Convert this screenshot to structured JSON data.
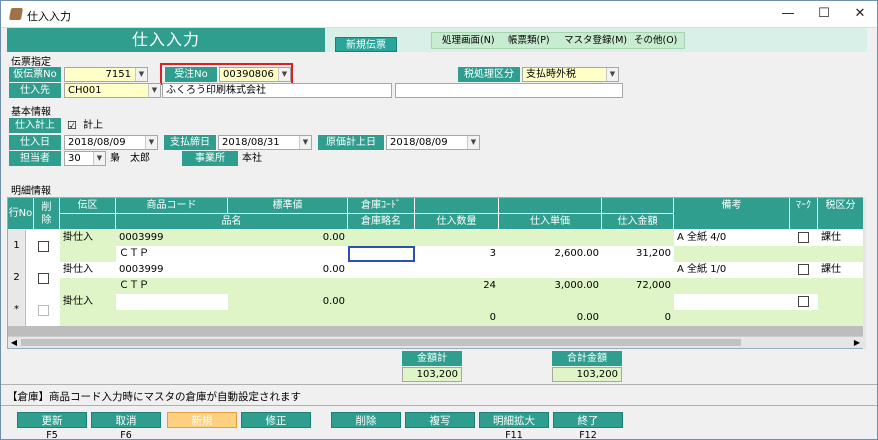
{
  "window": {
    "title": "仕入入力",
    "minimize": "—",
    "maximize": "☐",
    "close": "✕"
  },
  "header": {
    "title": "仕入入力",
    "mode_badge": "新規伝票"
  },
  "menu": [
    {
      "label": "処理画面(N)"
    },
    {
      "label": "帳票類(P)"
    },
    {
      "label": "マスタ登録(M)"
    },
    {
      "label": "その他(O)"
    }
  ],
  "denpyo": {
    "section": "伝票指定",
    "kari_label": "仮伝票No",
    "kari_value": "7151",
    "juchu_label": "受注No",
    "juchu_value": "00390806",
    "zei_label": "税処理区分",
    "zei_value": "支払時外税",
    "shiiresaki_label": "仕入先",
    "shiiresaki_code": "CH001",
    "shiiresaki_name": "ふくろう印刷株式会社"
  },
  "kihon": {
    "section": "基本情報",
    "keijo_label": "仕入計上",
    "keijo_check": "☑",
    "keijo_text": "計上",
    "shiirebi_label": "仕入日",
    "shiirebi_value": "2018/08/09",
    "shimebi_label": "支払締日",
    "shimebi_value": "2018/08/31",
    "genka_label": "原価計上日",
    "genka_value": "2018/08/09",
    "tanto_label": "担当者",
    "tanto_code": "30",
    "tanto_name": "梟　太郎",
    "jigyosho_label": "事業所",
    "jigyosho_value": "本社"
  },
  "meisai": {
    "section": "明細情報",
    "headers": {
      "gyono": "行No",
      "sakujo": "削\n除",
      "denku": "伝区",
      "shohin_code": "商品コード",
      "hyojunchi": "標準値",
      "soko_code": "倉庫ｺｰﾄﾞ",
      "hinmei": "品名",
      "soko_name": "倉庫略名",
      "suryo": "仕入数量",
      "tanka": "仕入単価",
      "kingaku": "仕入金額",
      "biko": "備考",
      "mark": "ﾏｰｸ",
      "zeiku": "税区分"
    },
    "rows": [
      {
        "no": "1",
        "denku": "掛仕入",
        "code": "0003999",
        "hyojun": "0.00",
        "hinmei": "ＣＴＰ",
        "suryo": "3",
        "tanka": "2,600.00",
        "kingaku": "31,200",
        "biko": "A 全紙 4/0",
        "zeiku": "課仕"
      },
      {
        "no": "2",
        "denku": "掛仕入",
        "code": "0003999",
        "hyojun": "0.00",
        "hinmei": "ＣＴＰ",
        "suryo": "24",
        "tanka": "3,000.00",
        "kingaku": "72,000",
        "biko": "A 全紙 1/0",
        "zeiku": "課仕"
      },
      {
        "no": "*",
        "denku": "掛仕入",
        "code": "",
        "hyojun": "0.00",
        "hinmei": "",
        "suryo": "0",
        "tanka": "0.00",
        "kingaku": "0",
        "biko": "",
        "zeiku": ""
      }
    ]
  },
  "totals": {
    "kingaku_label": "金額計",
    "kingaku_value": "103,200",
    "gokei_label": "合計金額",
    "gokei_value": "103,200"
  },
  "status": "【倉庫】商品コード入力時にマスタの倉庫が自動設定されます",
  "buttons": [
    {
      "label": "更新",
      "fkey": "F5"
    },
    {
      "label": "取消",
      "fkey": "F6"
    },
    {
      "label": "新規",
      "fkey": ""
    },
    {
      "label": "修正",
      "fkey": ""
    },
    {
      "label": "削除",
      "fkey": ""
    },
    {
      "label": "複写",
      "fkey": ""
    },
    {
      "label": "明細拡大",
      "fkey": "F11"
    },
    {
      "label": "終了",
      "fkey": "F12"
    }
  ],
  "colors": {
    "accent": "#2f9e8e",
    "highlight": "#ffd080",
    "required_outline": "#e02020"
  }
}
